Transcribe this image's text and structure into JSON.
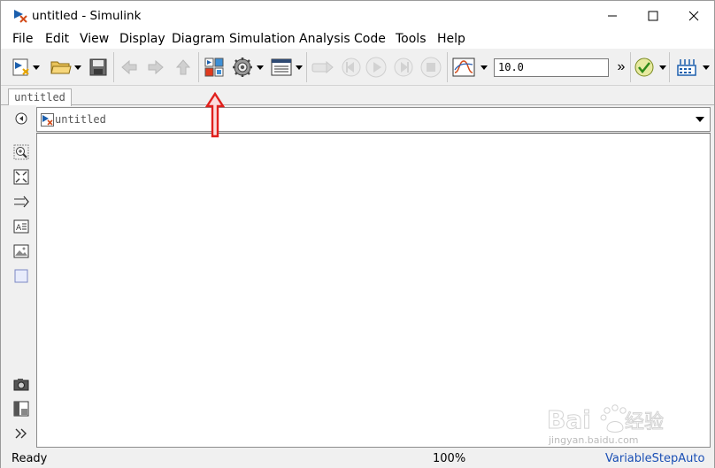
{
  "window": {
    "title": "untitled - Simulink",
    "controls": [
      "minimize",
      "maximize",
      "close"
    ]
  },
  "menu": {
    "items": [
      "File",
      "Edit",
      "View",
      "Display",
      "Diagram",
      "Simulation",
      "Analysis",
      "Code",
      "Tools",
      "Help"
    ]
  },
  "toolbar": {
    "stop_time": "10.0",
    "more_label": "»",
    "icons": [
      "new-model-icon",
      "open-folder-icon",
      "save-icon",
      "back-arrow-icon",
      "forward-arrow-icon",
      "up-arrow-icon",
      "library-browser-icon",
      "model-config-icon",
      "model-explorer-icon",
      "step-back-icon",
      "run-icon",
      "step-forward-icon",
      "stop-icon",
      "scope-icon",
      "model-advisor-icon",
      "build-icon"
    ]
  },
  "tabs": [
    {
      "label": "untitled"
    }
  ],
  "address": {
    "path": "untitled"
  },
  "palette": {
    "icons": [
      "back-icon",
      "zoom-icon",
      "fit-view-icon",
      "signal-arrow-icon",
      "annotation-icon",
      "image-icon",
      "area-icon",
      "camera-icon",
      "explorer-bar-icon",
      "expand-icon"
    ]
  },
  "status": {
    "left": "Ready",
    "zoom": "100%",
    "solver": "VariableStepAuto"
  },
  "colors": {
    "annotation_arrow": "#e0201c",
    "solver_link": "#1a4fb5"
  },
  "watermark": {
    "brand": "Baidu",
    "sub": "jingyan.baidu.com"
  }
}
